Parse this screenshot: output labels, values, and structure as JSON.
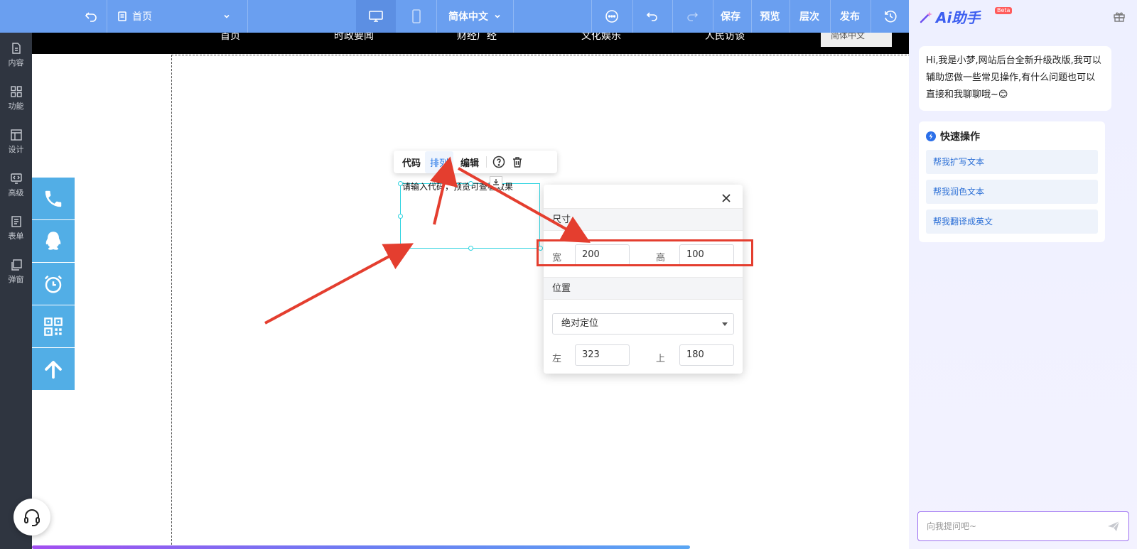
{
  "topbar": {
    "page_select": "首页",
    "language": "简体中文",
    "save": "保存",
    "preview": "预览",
    "layers": "层次",
    "publish": "发布"
  },
  "sidebar": {
    "items": [
      {
        "label": "内容",
        "icon": "content-icon"
      },
      {
        "label": "功能",
        "icon": "function-icon"
      },
      {
        "label": "设计",
        "icon": "design-icon"
      },
      {
        "label": "高级",
        "icon": "advanced-icon"
      },
      {
        "label": "表单",
        "icon": "form-icon"
      },
      {
        "label": "弹窗",
        "icon": "popup-icon"
      }
    ]
  },
  "site_nav": {
    "items": [
      "首页",
      "时政要闻",
      "财经广经",
      "文化娱乐",
      "人民访谈"
    ],
    "language_box": "简体中文"
  },
  "float_buttons": [
    "phone-icon",
    "qq-icon",
    "alarm-clock-icon",
    "qrcode-icon",
    "arrow-up-icon"
  ],
  "element_toolbar": {
    "tabs": [
      "代码",
      "排列",
      "编辑"
    ],
    "active_tab": "排列"
  },
  "selected_element": {
    "placeholder": "请输入代码，预览可查看效果"
  },
  "props_panel": {
    "size_section": "尺寸",
    "width_label": "宽",
    "width_value": "200",
    "height_label": "高",
    "height_value": "100",
    "position_section": "位置",
    "position_mode": "绝对定位",
    "left_label": "左",
    "left_value": "323",
    "top_label": "上",
    "top_value": "180"
  },
  "ai_panel": {
    "title": "Ai助手",
    "badge": "Beta",
    "greeting": "Hi,我是小梦,网站后台全新升级改版,我可以辅助您做一些常见操作,有什么问题也可以直接和我聊聊哦~😊",
    "quick_title": "快速操作",
    "quick_items": [
      "帮我扩写文本",
      "帮我润色文本",
      "帮我翻译成英文"
    ],
    "input_placeholder": "向我提问吧~"
  },
  "progress": 0.75,
  "colors": {
    "topbar": "#6a9ff0",
    "sidebar": "#2f3540",
    "float_button": "#52aee6",
    "highlight": "#e43e2f",
    "selection": "#2dd3e0"
  }
}
